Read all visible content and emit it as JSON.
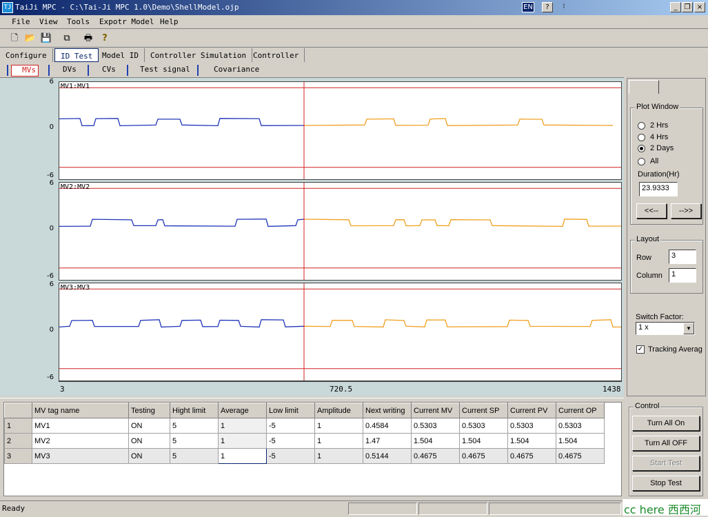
{
  "window": {
    "title": "TaiJi MPC - C:\\Tai-Ji MPC 1.0\\Demo\\ShellModel.ojp",
    "lang_badge": "EN",
    "help_badge": "?",
    "scroll_badge": "⁝",
    "minimize": "_",
    "restore": "❐",
    "close": "×",
    "app_icon": "TJ"
  },
  "menu": [
    {
      "label": "File"
    },
    {
      "label": "View"
    },
    {
      "label": "Tools"
    },
    {
      "label": "Expotr Model"
    },
    {
      "label": "Help"
    }
  ],
  "toolbar": {
    "icons": [
      "new-file-icon",
      "open-folder-icon",
      "save-disk-icon",
      "copy-icon",
      "print-icon",
      "help-question-icon"
    ],
    "glyphs": [
      "🗋",
      "📂",
      "💾",
      "⧉",
      "🖶",
      "?"
    ]
  },
  "main_tabs": [
    "Configure",
    "ID Test",
    "Model ID",
    "Controller Simulation",
    "Controller"
  ],
  "active_main_tab": "ID Test",
  "sub_tabs": [
    "MVs",
    "DVs",
    "CVs",
    "Test signal",
    "Covariance"
  ],
  "active_sub_tab": "MVs",
  "plots": [
    {
      "label": "MV1:MV1",
      "ymax": "6",
      "ymid": "0",
      "ymin": "-6"
    },
    {
      "label": "MV2:MV2",
      "ymax": "6",
      "ymid": "0",
      "ymin": "-6"
    },
    {
      "label": "MV3:MV3",
      "ymax": "6",
      "ymid": "0",
      "ymin": "-6"
    }
  ],
  "x_axis": {
    "left": "3",
    "mid": "720.5",
    "right": "1438"
  },
  "colors": {
    "past_series": "#1f35b8",
    "future_series": "#f0a020",
    "limits": "#d02020",
    "cursor": "#d02020"
  },
  "plot_window": {
    "title": "Plot Window",
    "options": [
      "2 Hrs",
      "4 Hrs",
      "2 Days",
      "All"
    ],
    "selected": "2 Days",
    "duration_label": "Duration(Hr)",
    "duration_value": "23.9333",
    "prev_button": "<<--",
    "next_button": "-->>"
  },
  "layout": {
    "title": "Layout",
    "row_label": "Row",
    "row_value": "3",
    "column_label": "Column",
    "column_value": "1"
  },
  "switch_factor": {
    "label": "Switch Factor:",
    "value": "1 x"
  },
  "tracking": {
    "label": "Tracking Averag",
    "checked": true
  },
  "table": {
    "columns": [
      "MV tag name",
      "Testing",
      "Hight limit",
      "Average",
      "Low limit",
      "Amplitude",
      "Next writing",
      "Current MV",
      "Current SP",
      "Current PV",
      "Current OP"
    ],
    "rows": [
      {
        "index": "1",
        "cells": [
          "MV1",
          "ON",
          "5",
          "1",
          "-5",
          "1",
          "0.4584",
          "0.5303",
          "0.5303",
          "0.5303",
          "0.5303"
        ]
      },
      {
        "index": "2",
        "cells": [
          "MV2",
          "ON",
          "5",
          "1",
          "-5",
          "1",
          "1.47",
          "1.504",
          "1.504",
          "1.504",
          "1.504"
        ]
      },
      {
        "index": "3",
        "cells": [
          "MV3",
          "ON",
          "5",
          "1",
          "-5",
          "1",
          "0.5144",
          "0.4675",
          "0.4675",
          "0.4675",
          "0.4675"
        ]
      }
    ]
  },
  "control": {
    "title": "Control",
    "buttons": [
      "Turn All On",
      "Turn All OFF",
      "Start Test",
      "Stop Test"
    ]
  },
  "status": {
    "text": "Ready"
  },
  "watermark": {
    "text": "cc here 西西河"
  }
}
